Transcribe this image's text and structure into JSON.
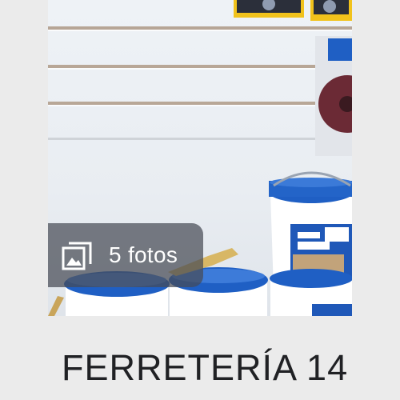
{
  "card": {
    "title": "FERRETERÍA 14",
    "photos_label": "5 fotos"
  },
  "icons": {
    "photos": "photo-library-icon"
  },
  "colors": {
    "background": "#ebebeb",
    "title_text": "#202124",
    "overlay": "#464b54",
    "bucket_lid": "#1f5fc4"
  }
}
